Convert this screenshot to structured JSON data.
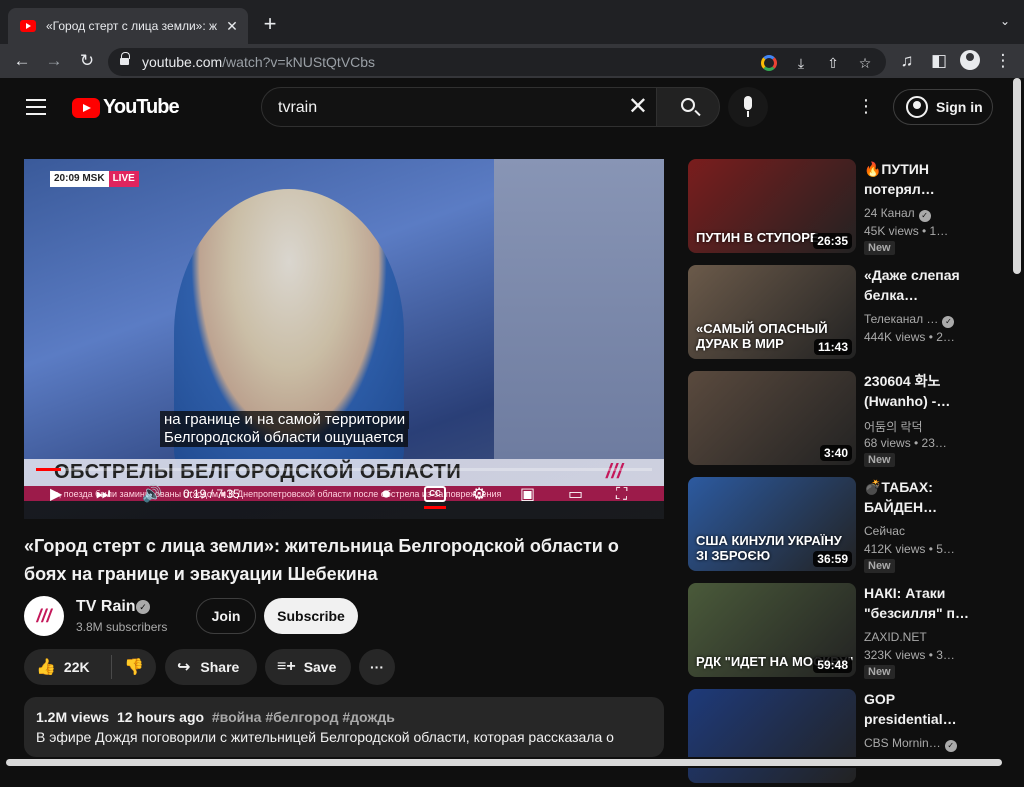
{
  "browser": {
    "tab_title": "«Город стерт с лица земли»: ж",
    "url_host": "youtube.com",
    "url_path": "/watch?v=kNUStQtVCbs"
  },
  "header": {
    "logo_text": "YouTube",
    "search_query": "tvrain",
    "signin_label": "Sign in"
  },
  "player": {
    "badge_time": "20:09 MSK",
    "badge_live": "LIVE",
    "subtitle_line1": "на границе и на самой территории",
    "subtitle_line2": "Белгородской области ощущается",
    "ticker_headline": "ОБСТРЕЛЫ БЕЛГОРОДСКОЙ ОБЛАСТИ",
    "ticker_crawl": "в, поезда были заминированы отходом   ■   В Днепропетровской области после обстрела из-за повреждения",
    "time_display": "0:19 / 7:35",
    "progress_fraction": 0.04,
    "cc_label": "CC"
  },
  "video": {
    "title": "«Город стерт с лица земли»: жительница Белгородской области о боях на границе и эвакуации Шебекина",
    "channel_name": "TV Rain",
    "channel_avatar_text": "///",
    "subscribers": "3.8M subscribers",
    "join_label": "Join",
    "subscribe_label": "Subscribe",
    "likes": "22K",
    "share_label": "Share",
    "save_label": "Save",
    "views": "1.2M views",
    "posted": "12 hours ago",
    "tags": "#война #белгород #дождь",
    "description": "В эфире Дождя поговорили с жительницей Белгородской области, которая рассказала о"
  },
  "recommendations": [
    {
      "title": "🔥ПУТИН потерял…",
      "channel": "24 Канал",
      "verified": true,
      "views": "45K views • 1…",
      "duration": "26:35",
      "is_new": true,
      "thumb_text": "ПУТИН В СТУПОРЕ",
      "thumb_color": "#7a1d1d"
    },
    {
      "title": "«Даже слепая белка…",
      "channel": "Телеканал …",
      "verified": true,
      "views": "444K views • 2…",
      "duration": "11:43",
      "is_new": false,
      "thumb_text": "«САМЫЙ ОПАСНЫЙ ДУРАК В МИР",
      "thumb_color": "#6b5a4a"
    },
    {
      "title": "230604 화노 (Hwanho) -…",
      "channel": "어둠의 락덕",
      "verified": false,
      "views": "68 views • 23…",
      "duration": "3:40",
      "is_new": true,
      "thumb_text": "",
      "thumb_color": "#5a4a3e"
    },
    {
      "title": "💣ТАБАХ: БАЙДЕН…",
      "channel": "Сейчас",
      "verified": false,
      "views": "412K views • 5…",
      "duration": "36:59",
      "is_new": true,
      "thumb_text": "США КИНУЛИ УКРАЇНУ ЗІ ЗБРОЄЮ",
      "thumb_color": "#2c5aa0"
    },
    {
      "title": "НАКІ: Атаки \"безсилля\" п…",
      "channel": "ZAXID.NET",
      "verified": false,
      "views": "323K views • 3…",
      "duration": "59:48",
      "is_new": true,
      "thumb_text": "РДК \"ИДЕТ НА МОСКВУ\"",
      "thumb_color": "#4a5a3a"
    },
    {
      "title": "GOP presidential…",
      "channel": "CBS Mornin…",
      "verified": true,
      "views": "",
      "duration": "",
      "is_new": false,
      "thumb_text": "",
      "thumb_color": "#1e3a7a"
    }
  ]
}
